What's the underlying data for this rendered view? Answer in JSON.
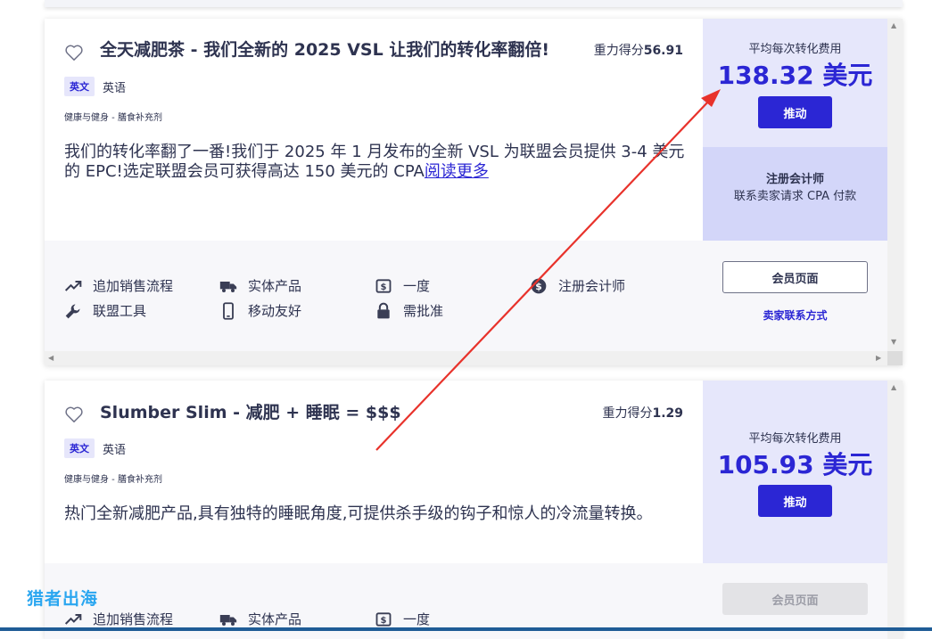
{
  "products": [
    {
      "title": "全天减肥茶 - 我们全新的 2025 VSL 让我们的转化率翻倍!",
      "gravity_label": "重力得分",
      "gravity_value": "56.91",
      "language_code": "英文",
      "language": "英语",
      "category": "健康与健身 - 膳食补充剂",
      "description": "我们的转化率翻了一番!我们于 2025 年 1 月发布的全新 VSL 为联盟会员提供 3-4 美元的 EPC!选定联盟会员可获得高达 150 美元的 CPA",
      "read_more": "阅读更多",
      "avg_label": "平均每次转化费用",
      "avg_value": "138.32 美元",
      "promote": "推动",
      "cpa_title": "注册会计师",
      "cpa_desc": "联系卖家请求 CPA 付款",
      "features": [
        {
          "icon": "trending-up-icon",
          "label": "追加销售流程"
        },
        {
          "icon": "truck-icon",
          "label": "实体产品"
        },
        {
          "icon": "dollar-bill-icon",
          "label": "一度"
        },
        {
          "icon": "dollar-coin-icon",
          "label": "注册会计师"
        },
        {
          "icon": "wrench-icon",
          "label": "联盟工具"
        },
        {
          "icon": "mobile-phone-icon",
          "label": "移动友好"
        },
        {
          "icon": "lock-icon",
          "label": "需批准"
        }
      ],
      "affiliate_page": "会员页面",
      "seller_contact": "卖家联系方式"
    },
    {
      "title": "Slumber Slim - 减肥 + 睡眠 = $$$",
      "gravity_label": "重力得分",
      "gravity_value": "1.29",
      "language_code": "英文",
      "language": "英语",
      "category": "健康与健身 - 膳食补充剂",
      "description": "热门全新减肥产品,具有独特的睡眠角度,可提供杀手级的钩子和惊人的冷流量转换。",
      "avg_label": "平均每次转化费用",
      "avg_value": "105.93 美元",
      "promote": "推动",
      "features": [
        {
          "icon": "trending-up-icon",
          "label": "追加销售流程"
        },
        {
          "icon": "truck-icon",
          "label": "实体产品"
        },
        {
          "icon": "dollar-bill-icon",
          "label": "一度"
        }
      ],
      "affiliate_page": "会员页面"
    }
  ],
  "watermark": "猎者出海",
  "colors": {
    "accent": "#2b26d4",
    "text": "#2e3350",
    "price_panel": "#e6e7fb",
    "cpa_panel": "#d3d6f9",
    "feature_bg": "#f7f7fa",
    "annotation_arrow": "#e8322b"
  }
}
